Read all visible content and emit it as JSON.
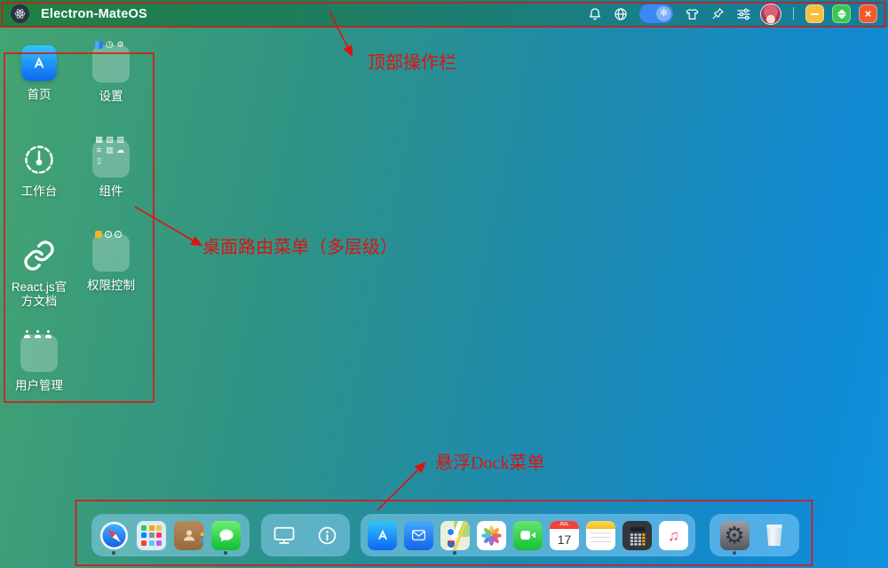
{
  "topbar": {
    "title": "Electron-MateOS",
    "icons": [
      "app-logo",
      "bell",
      "globe",
      "snowflake-toggle",
      "tshirt",
      "pin",
      "sliders",
      "avatar"
    ],
    "toggle_state": "on",
    "window_controls": [
      "minimize",
      "maximize",
      "close"
    ]
  },
  "desktop": {
    "items": [
      {
        "label": "首页",
        "icon": "appstore",
        "kind": "app"
      },
      {
        "label": "设置",
        "icon": "folder",
        "kind": "folder"
      },
      {
        "label": "工作台",
        "icon": "dashboard",
        "kind": "app"
      },
      {
        "label": "组件",
        "icon": "folder",
        "kind": "folder"
      },
      {
        "label": "React.js官方文档",
        "icon": "link",
        "kind": "app"
      },
      {
        "label": "权限控制",
        "icon": "folder",
        "kind": "folder"
      },
      {
        "label": "用户管理",
        "icon": "folder",
        "kind": "folder"
      }
    ]
  },
  "dock": {
    "groups": [
      {
        "items": [
          "safari",
          "launchpad",
          "contacts",
          "messages"
        ]
      },
      {
        "items": [
          "display",
          "info"
        ]
      },
      {
        "items": [
          "appstore",
          "mail",
          "maps",
          "photos",
          "facetime",
          "calendar",
          "notes",
          "calculator",
          "music"
        ]
      },
      {
        "items": [
          "system-preferences",
          "trash"
        ]
      }
    ],
    "running": [
      "safari",
      "messages",
      "maps",
      "system-preferences"
    ],
    "calendar": {
      "month": "JUL",
      "day": "17"
    }
  },
  "annotations": {
    "color": "#dc1412",
    "topbar": {
      "text": "顶部操作栏"
    },
    "desktop_menu": {
      "text": "桌面路由菜单（多层级）"
    },
    "dock": {
      "text": "悬浮Dock菜单"
    }
  },
  "colors": {
    "toggle_blue": "#3d87f5",
    "minimize_yellow": "#f6bf3f",
    "maximize_green": "#3dc553",
    "close_orange": "#f05a2e",
    "annotation_red": "#dc1412"
  }
}
